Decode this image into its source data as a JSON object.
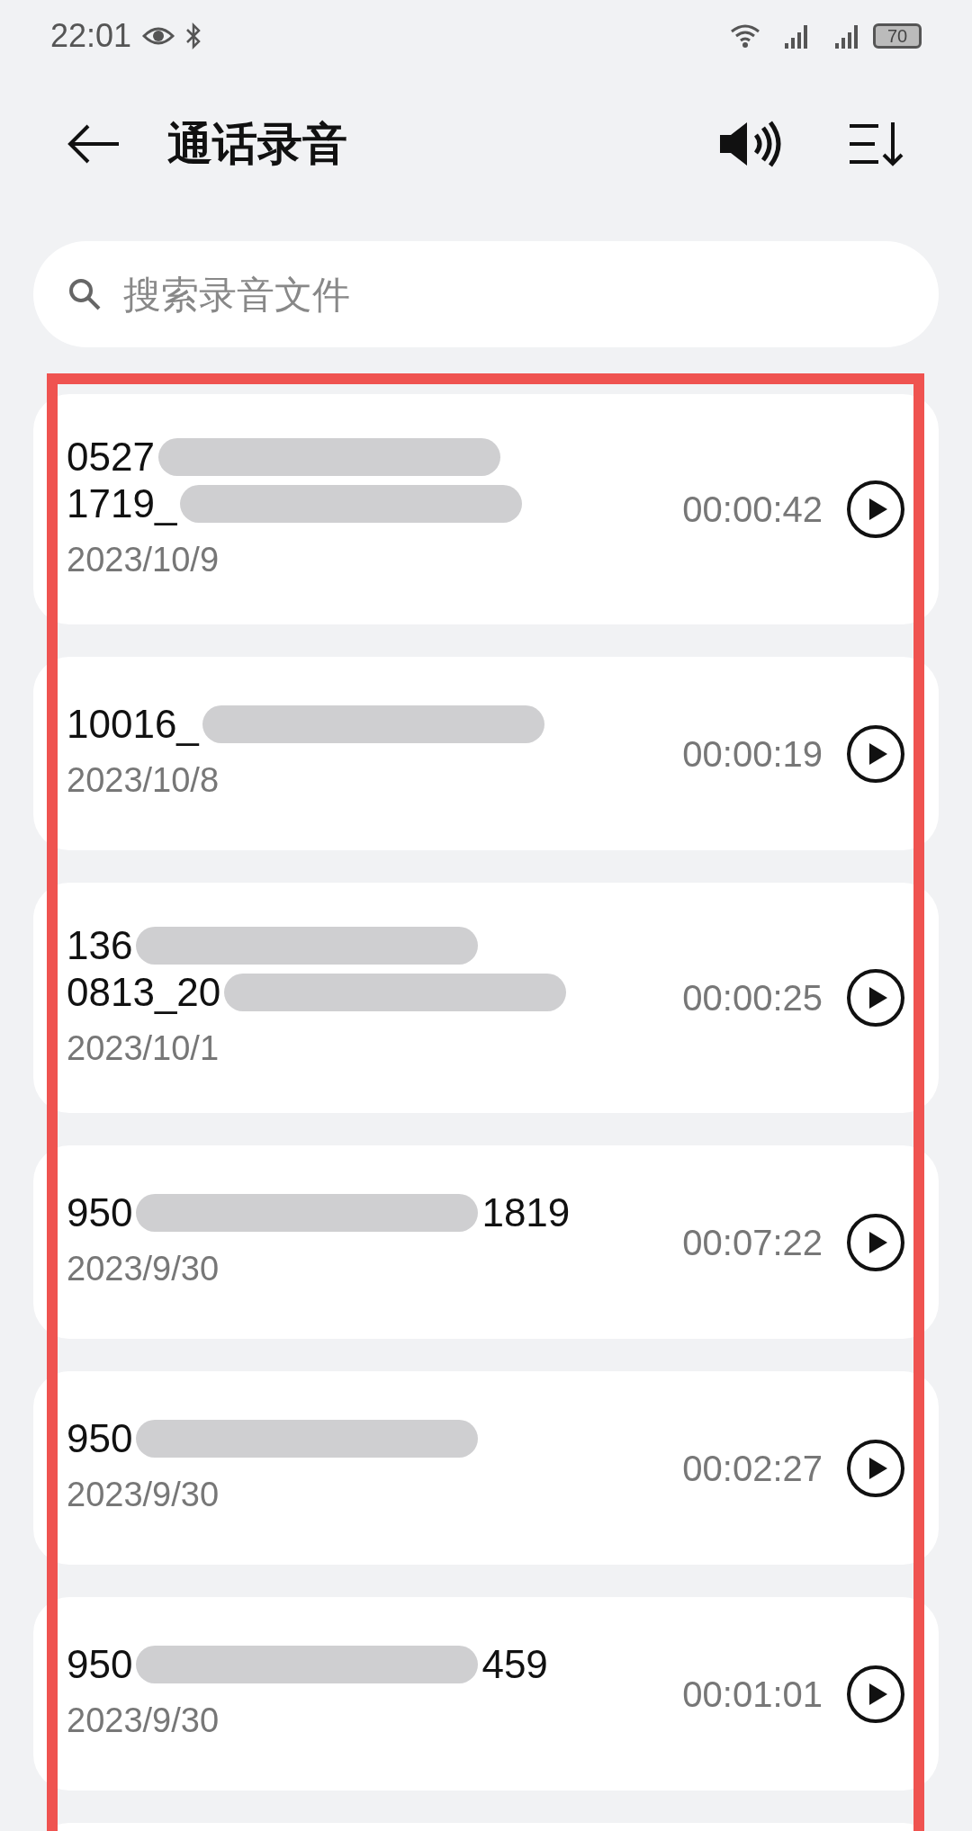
{
  "status_bar": {
    "time": "22:01",
    "battery": "70"
  },
  "header": {
    "title": "通话录音"
  },
  "search": {
    "placeholder": "搜索录音文件"
  },
  "recordings": [
    {
      "lines": [
        {
          "before": "0527"
        },
        {
          "before": "1719_"
        }
      ],
      "date": "2023/10/9",
      "duration": "00:00:42"
    },
    {
      "lines": [
        {
          "before": "10016_"
        }
      ],
      "date": "2023/10/8",
      "duration": "00:00:19"
    },
    {
      "lines": [
        {
          "before": "136"
        },
        {
          "before": "0813_20"
        }
      ],
      "date": "2023/10/1",
      "duration": "00:00:25"
    },
    {
      "lines": [
        {
          "before": "950",
          "after": "1819"
        }
      ],
      "date": "2023/9/30",
      "duration": "00:07:22"
    },
    {
      "lines": [
        {
          "before": "950"
        }
      ],
      "date": "2023/9/30",
      "duration": "00:02:27"
    },
    {
      "lines": [
        {
          "before": "950",
          "after": "459"
        }
      ],
      "date": "2023/9/30",
      "duration": "00:01:01"
    }
  ],
  "highlight_frame": {
    "shown": true
  }
}
